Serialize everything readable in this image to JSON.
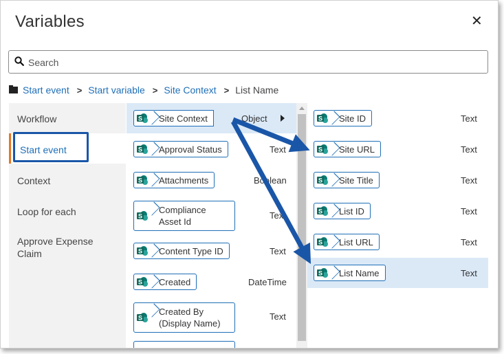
{
  "dialog": {
    "title": "Variables",
    "close_glyph": "✕"
  },
  "search": {
    "placeholder": "Search",
    "value": ""
  },
  "breadcrumb": {
    "items": [
      "Start event",
      "Start variable",
      "Site Context"
    ],
    "current": "List Name",
    "separator": ">"
  },
  "left_menu": {
    "items": [
      "Workflow",
      "Start event",
      "Context",
      "Loop for each",
      "Approve Expense Claim"
    ],
    "selected_index": 1,
    "accent_color": "#e87722",
    "highlight_color": "#1a56a8"
  },
  "middle_list": {
    "items": [
      {
        "label": "Site Context",
        "type": "Object",
        "expandable": true,
        "selected": true
      },
      {
        "label": "Approval Status",
        "type": "Text"
      },
      {
        "label": "Attachments",
        "type": "Boolean"
      },
      {
        "label": "Compliance Asset Id",
        "type": "Text"
      },
      {
        "label": "Content Type ID",
        "type": "Text"
      },
      {
        "label": "Created",
        "type": "DateTime"
      },
      {
        "label": "Created By (Display Name)",
        "type": "Text"
      }
    ]
  },
  "right_list": {
    "items": [
      {
        "label": "Site ID",
        "type": "Text"
      },
      {
        "label": "Site URL",
        "type": "Text"
      },
      {
        "label": "Site Title",
        "type": "Text"
      },
      {
        "label": "List ID",
        "type": "Text"
      },
      {
        "label": "List URL",
        "type": "Text"
      },
      {
        "label": "List Name",
        "type": "Text",
        "selected": true
      }
    ]
  },
  "icons": {
    "variable_icon": "sharepoint-icon",
    "expand": "triangle-right-icon"
  },
  "colors": {
    "link": "#1f6fb8",
    "pill_border": "#1e6eb6",
    "selected_row": "#dbe9f7",
    "sharepoint": "#0b7a72"
  }
}
